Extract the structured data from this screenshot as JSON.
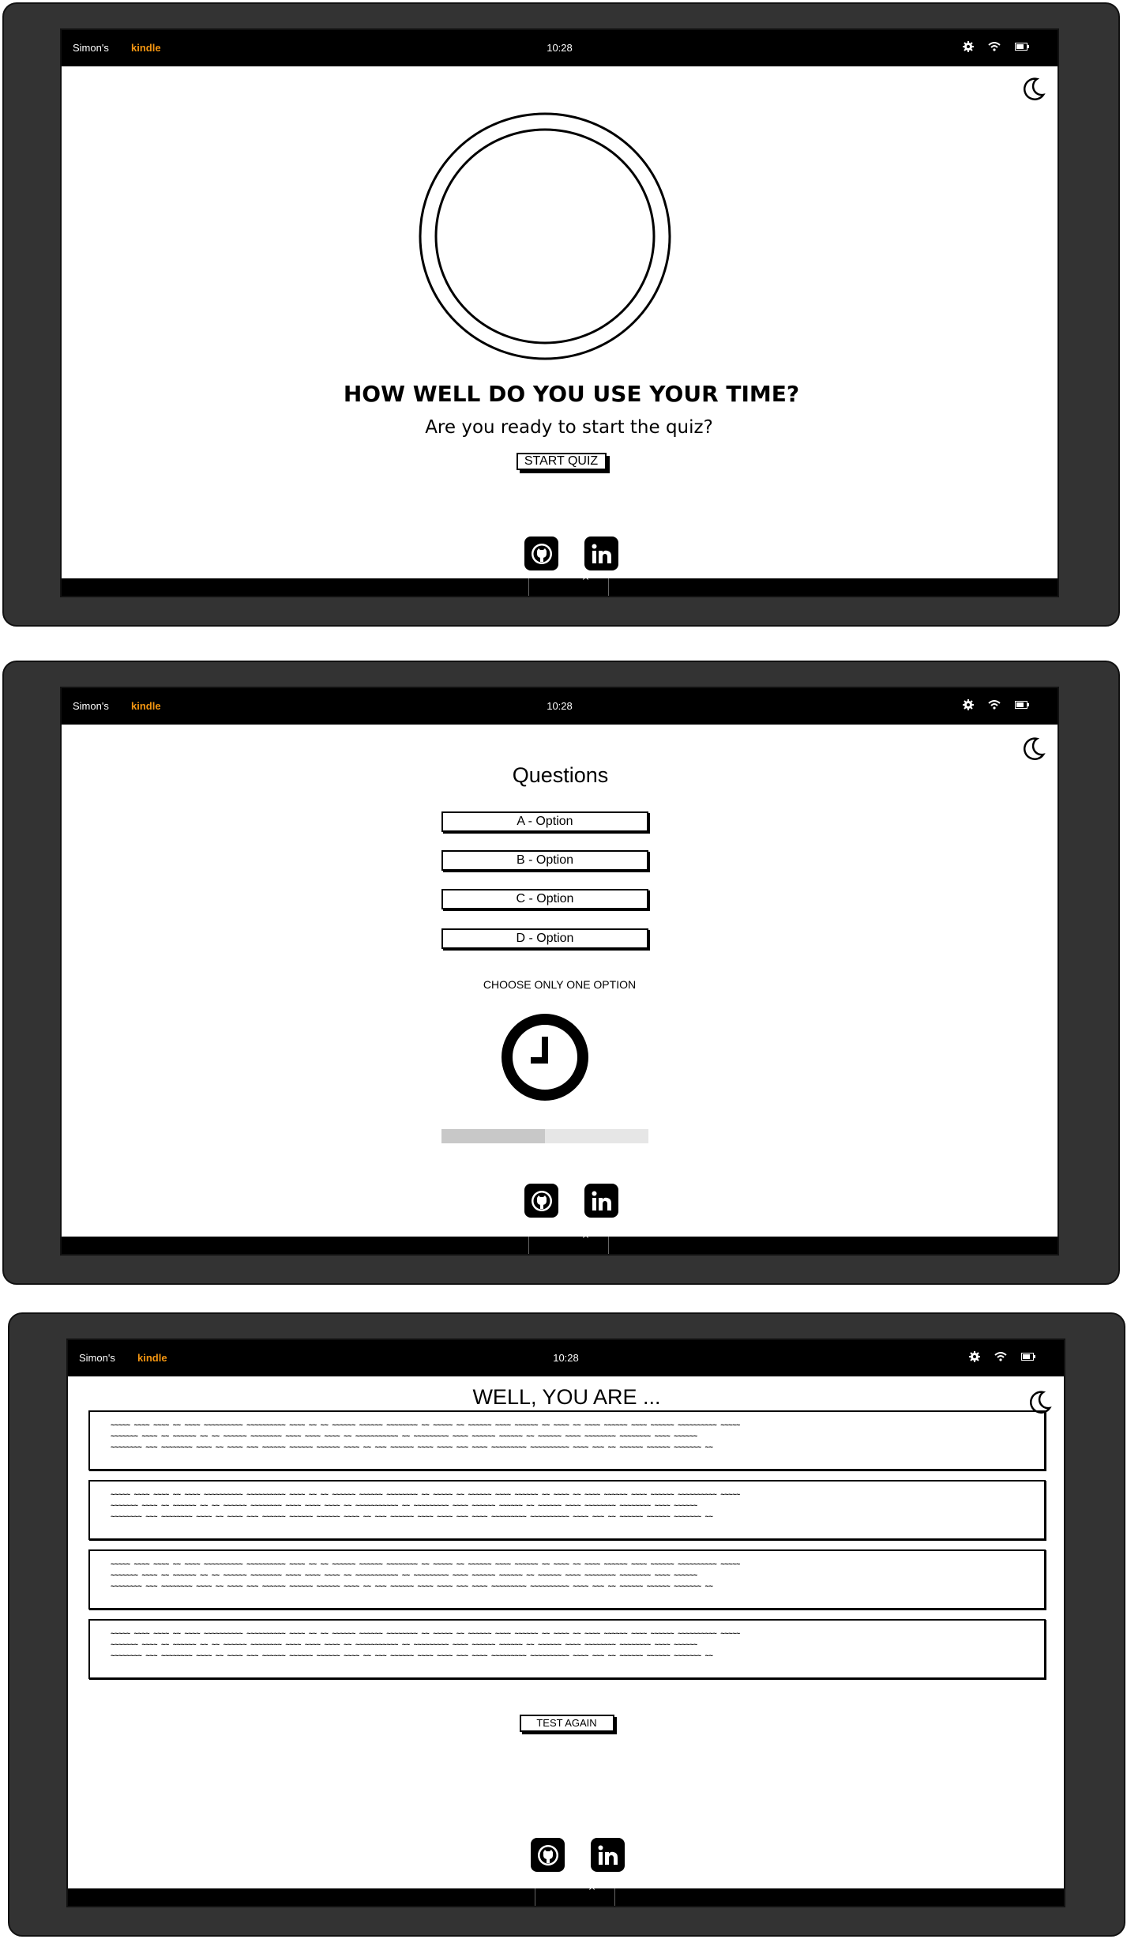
{
  "status_bar": {
    "owner": "Simon's",
    "brand": "kindle",
    "brand_color": "#f29511",
    "time": "10:28",
    "icons": [
      "gear-icon",
      "wifi-icon",
      "battery-icon"
    ]
  },
  "screens": {
    "start": {
      "title": "HOW WELL DO YOU USE YOUR TIME?",
      "subtitle": "Are you ready to start the quiz?",
      "start_button": "START QUIZ"
    },
    "quiz": {
      "heading": "Questions",
      "options": [
        "A - Option",
        "B - Option",
        "C - Option",
        "D - Option"
      ],
      "instruction": "CHOOSE ONLY ONE OPTION",
      "progress": 0.5
    },
    "result": {
      "heading": "WELL, YOU ARE ...",
      "paragraph_lines": [
        "~~~~~ ~~~~ ~~~~ ~~ ~~~~ ~~~~~~~~~~ ~~~~~~~~~~ ~~~~ ~~ ~~ ~~~~~~ ~~~~~~ ~~~~~~~~ ~~ ~~~~~ ~~ ~~~~~~ ~~~~ ~~~~~~ ~~ ~~~~ ~~ ~~~~ ~~~~~~ ~~~~ ~~~~~~ ~~~~~~~~~~ ~~~~~",
        "~~~~~~~ ~~~~ ~~ ~~~~~~ ~~ ~~ ~~~~~~ ~~~~~~~~ ~~~~ ~~~~ ~~~~ ~~ ~~~~~~~~~~~ ~~ ~~~~~~~~~ ~~~~ ~~~~~~ ~~~~~~ ~~ ~~~~~~ ~~~~ ~~~~~~~~ ~~~~~~~~ ~~~~ ~~~~~~",
        "~~~~~~~~ ~~~ ~~~~~~~~ ~~~~ ~~ ~~~~ ~~~ ~~~~~~ ~~~~~~ ~~~~~~ ~~~~ ~~ ~~~ ~~~~~~ ~~~~ ~~~~ ~~~ ~~~~ ~~~~~~~~~ ~~~~~~~~~~ ~~~~ ~~~ ~~ ~~~~~~ ~~~~~~ ~~~~~~~ ~~"
      ],
      "again_button": "TEST AGAIN"
    }
  },
  "footer_icons": [
    "github-icon",
    "linkedin-icon"
  ]
}
